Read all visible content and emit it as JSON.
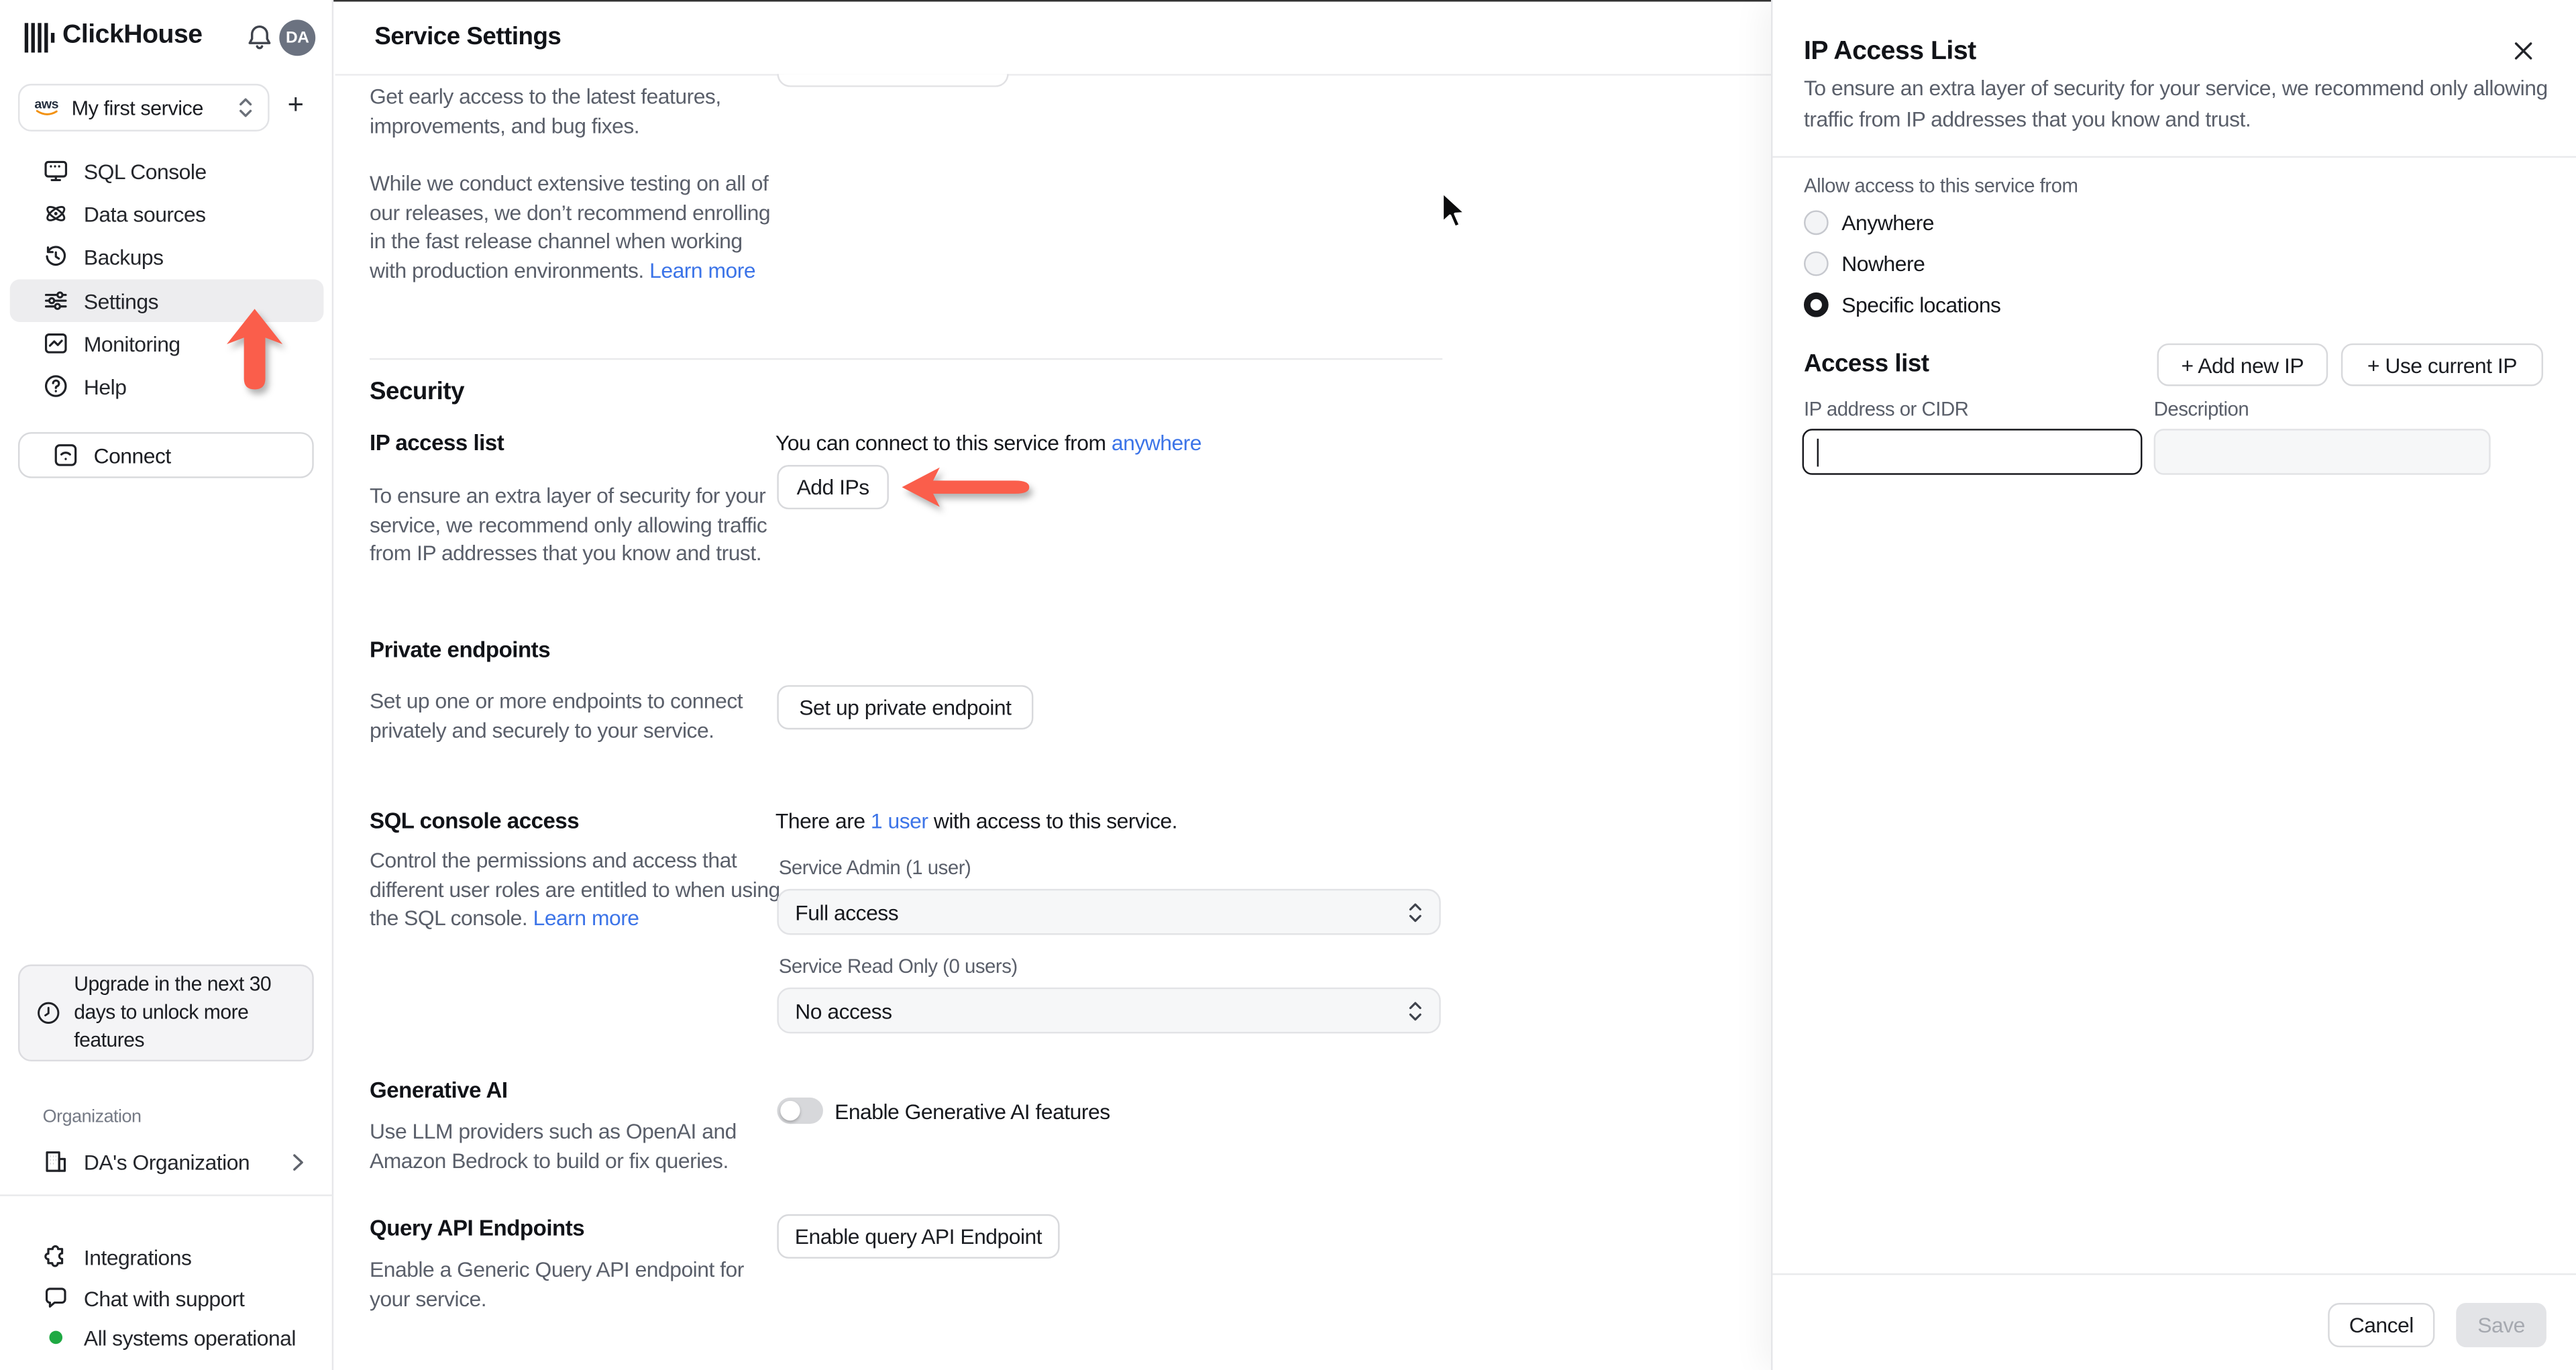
{
  "colors": {
    "accent_red": "#fa5e4b",
    "link_blue": "#3c74e8",
    "status_green": "#1fa943",
    "selected_nav_bg": "#ededef"
  },
  "topbar": {
    "brand": "ClickHouse",
    "avatar_initials": "DA"
  },
  "sidebar": {
    "service_selector": {
      "label": "My first service",
      "cloud": "aws"
    },
    "nav": [
      "SQL Console",
      "Data sources",
      "Backups",
      "Settings",
      "Monitoring",
      "Help"
    ],
    "selected_nav": "Settings",
    "connect_label": "Connect",
    "upgrade_note": "Upgrade in the next 30 days to unlock more features",
    "organization_label": "Organization",
    "organization_name": "DA's Organization",
    "footer": {
      "integrations": "Integrations",
      "chat": "Chat with support",
      "status": "All systems operational"
    }
  },
  "main": {
    "title": "Service Settings",
    "fast_release": {
      "p1": "Get early access to the latest features, improvements, and bug fixes.",
      "p2": "While we conduct extensive testing on all of our releases, we don’t recommend enrolling in the fast release channel when working with production environments. ",
      "learn_more": "Learn more"
    },
    "security_heading": "Security",
    "ip_access": {
      "heading": "IP access list",
      "desc": "To ensure an extra layer of security for your service, we recommend only allowing traffic from IP addresses that you know and trust.",
      "connect_prefix": "You can connect to this service from ",
      "connect_link": "anywhere",
      "add_ips": "Add IPs"
    },
    "private_endpoints": {
      "heading": "Private endpoints",
      "desc": "Set up one or more endpoints to connect privately and securely to your service.",
      "button": "Set up private endpoint"
    },
    "sql_access": {
      "heading": "SQL console access",
      "users_prefix": "There are ",
      "users_link": "1 user",
      "users_suffix": " with access to this service.",
      "desc": "Control the permissions and access that different user roles are entitled to when using the SQL console. ",
      "learn_more": "Learn more",
      "admin_label": "Service Admin (1 user)",
      "admin_value": "Full access",
      "readonly_label": "Service Read Only (0 users)",
      "readonly_value": "No access"
    },
    "generative_ai": {
      "heading": "Generative AI",
      "desc": "Use LLM providers such as OpenAI and Amazon Bedrock to build or fix queries.",
      "toggle_label": "Enable Generative AI features",
      "toggle_state": "off"
    },
    "query_api": {
      "heading": "Query API Endpoints",
      "desc": "Enable a Generic Query API endpoint for your service.",
      "button": "Enable query API Endpoint"
    }
  },
  "panel": {
    "title": "IP Access List",
    "desc": "To ensure an extra layer of security for your service, we recommend only allowing traffic from IP addresses that you know and trust.",
    "allow_label": "Allow access to this service from",
    "radios": [
      {
        "label": "Anywhere",
        "selected": false
      },
      {
        "label": "Nowhere",
        "selected": false
      },
      {
        "label": "Specific locations",
        "selected": true
      }
    ],
    "access_list_heading": "Access list",
    "add_new_ip": "+  Add new IP",
    "use_current_ip": "+  Use current IP",
    "ip_field": {
      "label": "IP address or CIDR",
      "value": "",
      "focused": true
    },
    "desc_field": {
      "label": "Description",
      "value": ""
    },
    "cancel": "Cancel",
    "save": "Save"
  }
}
